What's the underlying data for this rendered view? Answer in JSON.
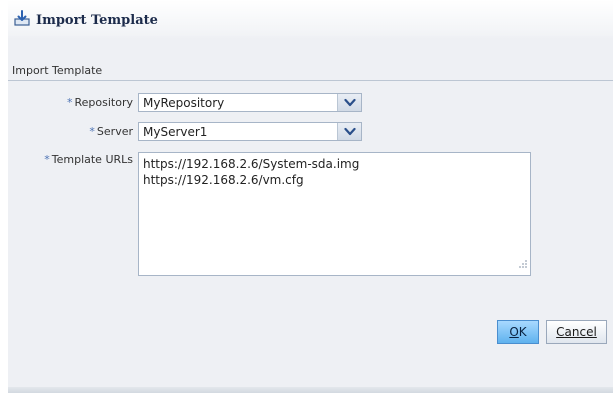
{
  "dialog": {
    "title": "Import Template",
    "section_header": "Import Template"
  },
  "form": {
    "required_marker": "*",
    "repository_label": "Repository",
    "repository_value": "MyRepository",
    "server_label": "Server",
    "server_value": "MyServer1",
    "urls_label": "Template URLs",
    "urls": [
      "https://192.168.2.6/System-sda.img",
      "https://192.168.2.6/vm.cfg"
    ]
  },
  "buttons": {
    "ok_mnemonic": "O",
    "ok_rest": "K",
    "cancel_mnemonic": "C",
    "cancel_rest": "ancel"
  },
  "icons": {
    "title": "import-icon",
    "dropdown": "chevron-down-icon",
    "resize": "resize-grip-icon"
  },
  "colors": {
    "ok_button": "#5fb2ee",
    "required_marker": "#4d73b4",
    "title_text": "#1c2b4b"
  }
}
